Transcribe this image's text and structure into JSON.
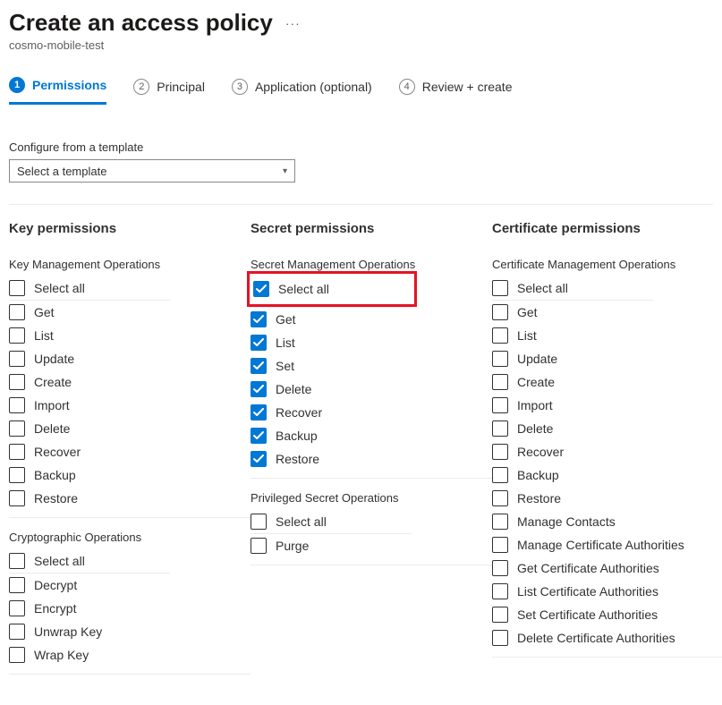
{
  "header": {
    "title": "Create an access policy",
    "subtitle": "cosmo-mobile-test"
  },
  "tabs": [
    {
      "num": "1",
      "label": "Permissions",
      "active": true
    },
    {
      "num": "2",
      "label": "Principal",
      "active": false
    },
    {
      "num": "3",
      "label": "Application (optional)",
      "active": false
    },
    {
      "num": "4",
      "label": "Review + create",
      "active": false
    }
  ],
  "template_section": {
    "label": "Configure from a template",
    "placeholder": "Select a template"
  },
  "columns": {
    "key": {
      "title": "Key permissions",
      "groups": [
        {
          "label": "Key Management Operations",
          "items": [
            {
              "label": "Select all",
              "checked": false
            },
            {
              "label": "Get",
              "checked": false
            },
            {
              "label": "List",
              "checked": false
            },
            {
              "label": "Update",
              "checked": false
            },
            {
              "label": "Create",
              "checked": false
            },
            {
              "label": "Import",
              "checked": false
            },
            {
              "label": "Delete",
              "checked": false
            },
            {
              "label": "Recover",
              "checked": false
            },
            {
              "label": "Backup",
              "checked": false
            },
            {
              "label": "Restore",
              "checked": false
            }
          ]
        },
        {
          "label": "Cryptographic Operations",
          "items": [
            {
              "label": "Select all",
              "checked": false
            },
            {
              "label": "Decrypt",
              "checked": false
            },
            {
              "label": "Encrypt",
              "checked": false
            },
            {
              "label": "Unwrap Key",
              "checked": false
            },
            {
              "label": "Wrap Key",
              "checked": false
            }
          ]
        }
      ]
    },
    "secret": {
      "title": "Secret permissions",
      "groups": [
        {
          "label": "Secret Management Operations",
          "highlight_first": true,
          "items": [
            {
              "label": "Select all",
              "checked": true
            },
            {
              "label": "Get",
              "checked": true
            },
            {
              "label": "List",
              "checked": true
            },
            {
              "label": "Set",
              "checked": true
            },
            {
              "label": "Delete",
              "checked": true
            },
            {
              "label": "Recover",
              "checked": true
            },
            {
              "label": "Backup",
              "checked": true
            },
            {
              "label": "Restore",
              "checked": true
            }
          ]
        },
        {
          "label": "Privileged Secret Operations",
          "items": [
            {
              "label": "Select all",
              "checked": false
            },
            {
              "label": "Purge",
              "checked": false
            }
          ]
        }
      ]
    },
    "cert": {
      "title": "Certificate permissions",
      "groups": [
        {
          "label": "Certificate Management Operations",
          "items": [
            {
              "label": "Select all",
              "checked": false
            },
            {
              "label": "Get",
              "checked": false
            },
            {
              "label": "List",
              "checked": false
            },
            {
              "label": "Update",
              "checked": false
            },
            {
              "label": "Create",
              "checked": false
            },
            {
              "label": "Import",
              "checked": false
            },
            {
              "label": "Delete",
              "checked": false
            },
            {
              "label": "Recover",
              "checked": false
            },
            {
              "label": "Backup",
              "checked": false
            },
            {
              "label": "Restore",
              "checked": false
            },
            {
              "label": "Manage Contacts",
              "checked": false
            },
            {
              "label": "Manage Certificate Authorities",
              "checked": false
            },
            {
              "label": "Get Certificate Authorities",
              "checked": false
            },
            {
              "label": "List Certificate Authorities",
              "checked": false
            },
            {
              "label": "Set Certificate Authorities",
              "checked": false
            },
            {
              "label": "Delete Certificate Authorities",
              "checked": false
            }
          ]
        }
      ]
    }
  }
}
